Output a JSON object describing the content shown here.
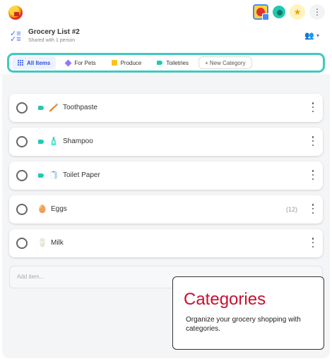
{
  "top_bar": {
    "icons": [
      "app-logo-icon",
      "user-avatar-icon",
      "collaborator-avatar-icon",
      "star-icon",
      "more-vertical-icon"
    ]
  },
  "header": {
    "title": "Grocery List #2",
    "subtitle": "Shared with 1 person",
    "share_icon": "people-icon"
  },
  "categories": {
    "items": [
      {
        "label": "All Items",
        "icon": "grid-icon",
        "active": true
      },
      {
        "label": "For Pets",
        "icon": "diamond-icon",
        "color": "#9775fa"
      },
      {
        "label": "Produce",
        "icon": "square-icon",
        "color": "#fcc419"
      },
      {
        "label": "Toiletries",
        "icon": "tag-icon",
        "color": "#20c9b0"
      }
    ],
    "new_label": "+ New Category"
  },
  "items": [
    {
      "name": "Toothpaste",
      "emoji": "🪥",
      "tagged": true,
      "qty": ""
    },
    {
      "name": "Shampoo",
      "emoji": "🧴",
      "tagged": true,
      "qty": ""
    },
    {
      "name": "Toilet Paper",
      "emoji": "🧻",
      "tagged": true,
      "qty": ""
    },
    {
      "name": "Eggs",
      "emoji": "🥚",
      "tagged": false,
      "qty": "(12)"
    },
    {
      "name": "Milk",
      "emoji": "🥛",
      "tagged": false,
      "qty": ""
    }
  ],
  "add_item": {
    "placeholder": "Add item..."
  },
  "callout": {
    "title": "Categories",
    "description": "Organize your grocery shopping with categories."
  },
  "colors": {
    "accent": "#4c6ef5",
    "highlight_border": "#3ec9c1",
    "callout_title": "#c8102e"
  }
}
